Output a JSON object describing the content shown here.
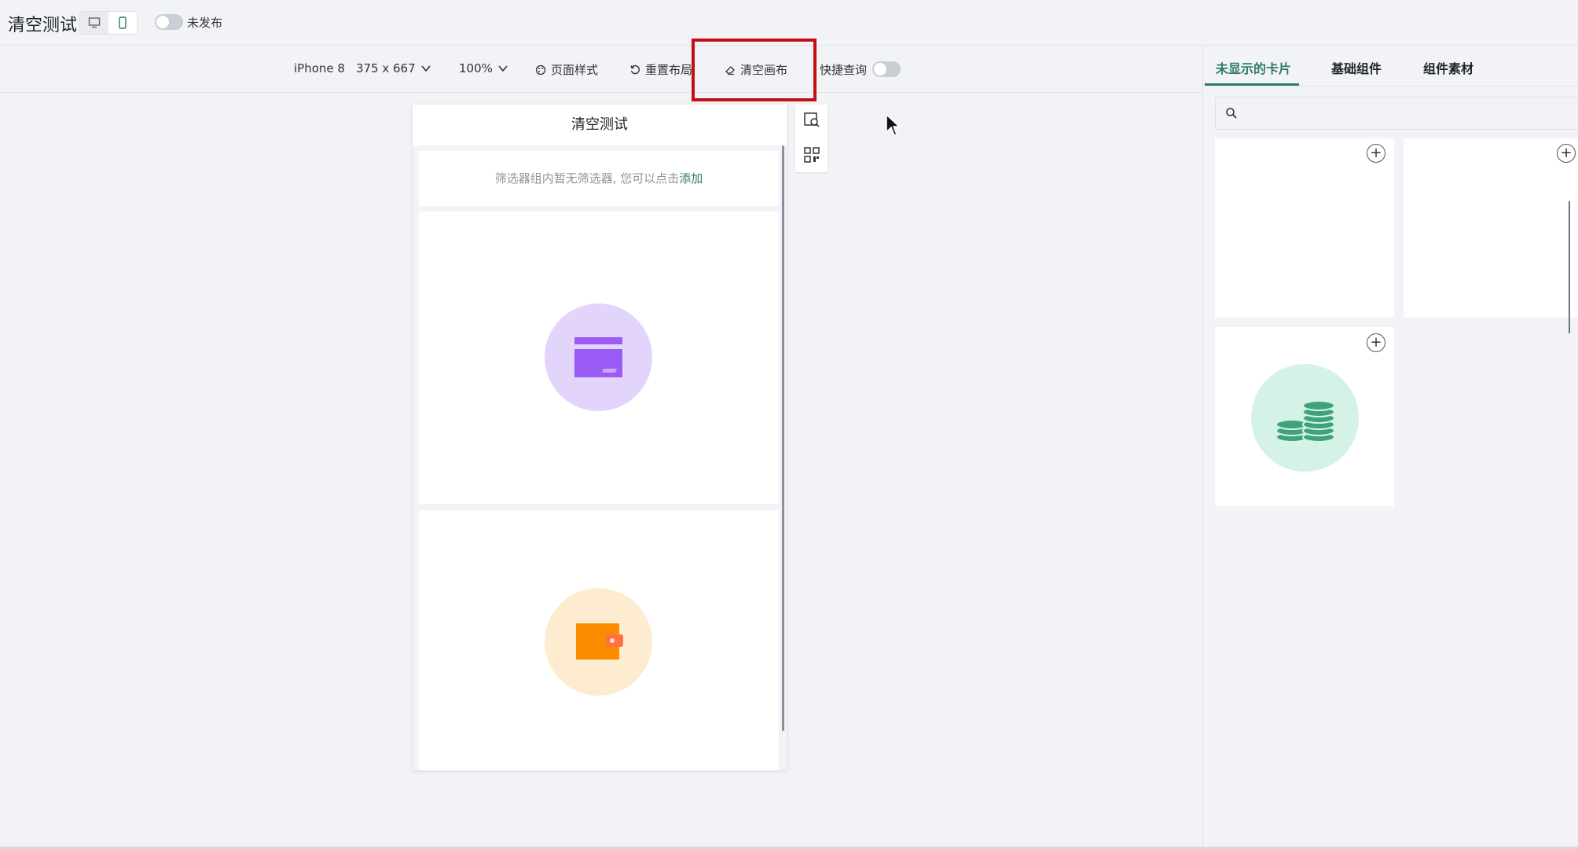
{
  "header": {
    "title": "清空测试",
    "publish_status": "未发布",
    "device_modes": [
      "desktop-icon",
      "mobile-icon"
    ],
    "active_device": "mobile"
  },
  "toolbar": {
    "device_name": "iPhone 8",
    "device_size": "375 x 667",
    "zoom": "100%",
    "page_style": "页面样式",
    "reset_layout": "重置布局",
    "clear_canvas": "清空画布",
    "quick_query": "快捷查询"
  },
  "phone": {
    "page_title": "清空测试",
    "filter_message": "筛选器组内暂无筛选器, 您可以点击",
    "filter_add_link": "添加",
    "cards": [
      {
        "icon": "credit-card-icon",
        "circle_color": "#e3d4fb",
        "icon_color": "#9b5cf6"
      },
      {
        "icon": "wallet-icon",
        "circle_color": "#fdecd0",
        "icon_color": "#fb8c00"
      }
    ]
  },
  "side_tools": [
    "preview-icon",
    "qr-code-icon"
  ],
  "right_panel": {
    "tabs": [
      "未显示的卡片",
      "基础组件",
      "组件素材"
    ],
    "active_tab": "未显示的卡片",
    "cards": [
      {
        "icon": "none"
      },
      {
        "icon": "none"
      },
      {
        "icon": "coins-icon",
        "circle_color": "#d4f2e6",
        "icon_color": "#3fa37a"
      }
    ]
  },
  "colors": {
    "accent": "#2f7b6c",
    "highlight": "#c40d16",
    "background": "#f2f3f7"
  }
}
